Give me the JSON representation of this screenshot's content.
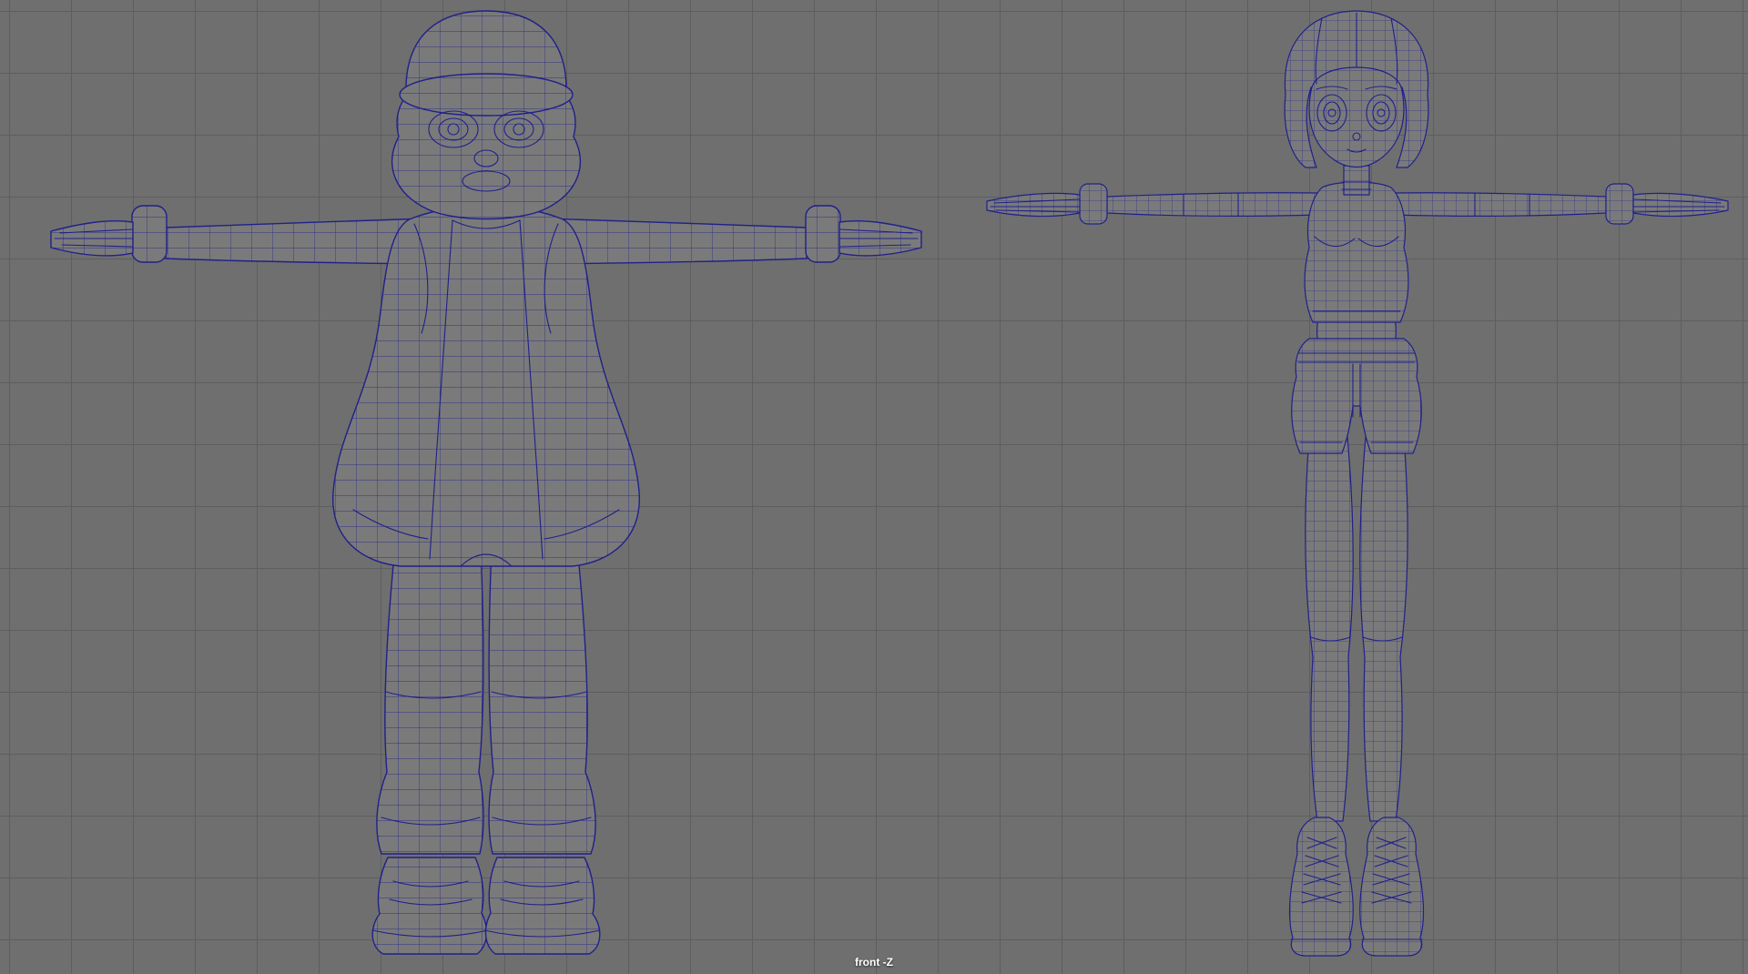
{
  "viewport": {
    "axis_label": "front -Z",
    "view": "front orthographic",
    "models": [
      {
        "name": "stocky character with cap and vest",
        "pose": "T-pose",
        "position": "left"
      },
      {
        "name": "slim character with crop top, shorts and boots",
        "pose": "T-pose",
        "position": "right"
      }
    ]
  },
  "colors": {
    "bg": "#6f6f6f",
    "grid-line": "#5e5e5e",
    "wireframe": "#20208c",
    "model-fill": "#7a7a7a",
    "label-text": "#ffffff"
  }
}
